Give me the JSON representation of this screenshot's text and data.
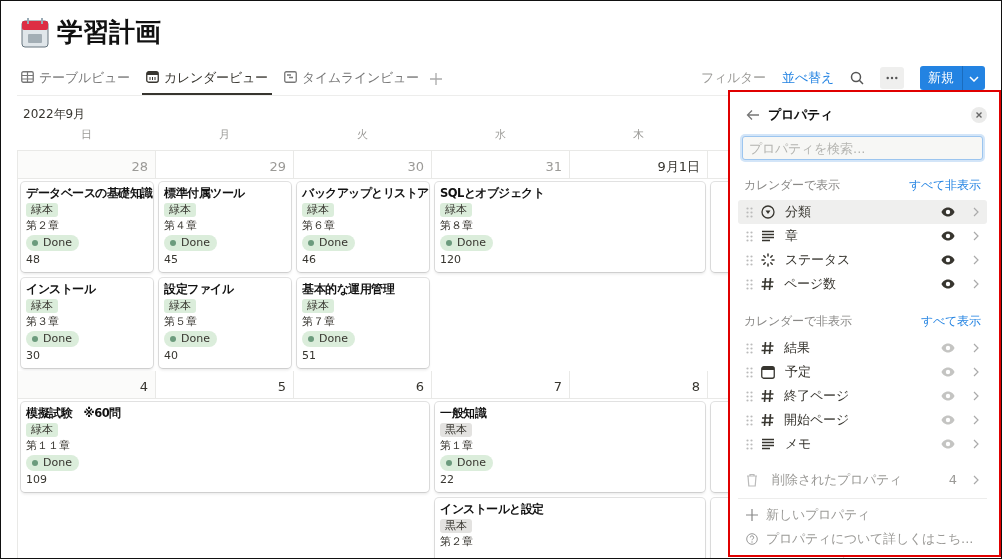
{
  "page": {
    "title": "学習計画"
  },
  "tabs": [
    {
      "label": "テーブルビュー",
      "kind": "table",
      "selected": false
    },
    {
      "label": "カレンダービュー",
      "kind": "calendar",
      "selected": true
    },
    {
      "label": "タイムラインビュー",
      "kind": "timeline",
      "selected": false
    }
  ],
  "toolbar": {
    "filter": "フィルター",
    "sort": "並べ替え",
    "new_button": "新規"
  },
  "calendar": {
    "month": "2022年9月",
    "weekdays": [
      "日",
      "月",
      "火",
      "水",
      "木"
    ],
    "weeks": [
      {
        "days": [
          {
            "kind": "date",
            "label": "28",
            "outside_month": true
          },
          {
            "kind": "date",
            "label": "29",
            "outside_month": true
          },
          {
            "kind": "date",
            "label": "30",
            "outside_month": true
          },
          {
            "kind": "date",
            "label": "31",
            "outside_month": true
          },
          {
            "kind": "date",
            "label": "9月1日",
            "outside_month": false
          },
          {
            "kind": "covered"
          },
          {
            "kind": "covered"
          }
        ],
        "lanes": [
          [
            {
              "kind": "event",
              "title": "データベースの基礎知識",
              "tag": {
                "text": "緑本",
                "color": "#dbeddb"
              },
              "chapter": "第２章",
              "status": "Done",
              "pages": "48"
            },
            {
              "kind": "event",
              "title": "標準付属ツール",
              "tag": {
                "text": "緑本",
                "color": "#dbeddb"
              },
              "chapter": "第４章",
              "status": "Done",
              "pages": "45"
            },
            {
              "kind": "event",
              "title": "バックアップとリストア",
              "tag": {
                "text": "緑本",
                "color": "#dbeddb"
              },
              "chapter": "第６章",
              "status": "Done",
              "pages": "46"
            },
            {
              "kind": "event",
              "title": "SQLとオブジェクト",
              "tag": {
                "text": "緑本",
                "color": "#dbeddb"
              },
              "chapter": "第８章",
              "status": "Done",
              "pages": "120"
            },
            {
              "kind": "continued"
            },
            {
              "kind": "covered"
            },
            {
              "kind": "empty"
            }
          ],
          [
            {
              "kind": "event",
              "title": "インストール",
              "tag": {
                "text": "緑本",
                "color": "#dbeddb"
              },
              "chapter": "第３章",
              "status": "Done",
              "pages": "30"
            },
            {
              "kind": "event",
              "title": "設定ファイル",
              "tag": {
                "text": "緑本",
                "color": "#dbeddb"
              },
              "chapter": "第５章",
              "status": "Done",
              "pages": "40"
            },
            {
              "kind": "event",
              "title": "基本的な運用管理",
              "tag": {
                "text": "緑本",
                "color": "#dbeddb"
              },
              "chapter": "第７章",
              "status": "Done",
              "pages": "51"
            },
            {
              "kind": "empty"
            },
            {
              "kind": "empty"
            },
            {
              "kind": "empty"
            },
            {
              "kind": "empty"
            }
          ]
        ]
      },
      {
        "days": [
          {
            "kind": "date",
            "label": "4",
            "outside_month": false
          },
          {
            "kind": "date",
            "label": "5",
            "outside_month": false
          },
          {
            "kind": "date",
            "label": "6",
            "outside_month": false
          },
          {
            "kind": "date",
            "label": "7",
            "outside_month": false
          },
          {
            "kind": "date",
            "label": "8",
            "outside_month": false
          },
          {
            "kind": "covered"
          },
          {
            "kind": "covered"
          }
        ],
        "lanes": [
          [
            {
              "kind": "event",
              "title": "模擬試験　※60問",
              "tag": {
                "text": "緑本",
                "color": "#dbeddb"
              },
              "chapter": "第１１章",
              "status": "Done",
              "pages": "109"
            },
            {
              "kind": "continued"
            },
            {
              "kind": "continued"
            },
            {
              "kind": "event",
              "title": "一般知識",
              "tag": {
                "text": "黒本",
                "color": "#e3e2e0"
              },
              "chapter": "第１章",
              "status": "Done",
              "pages": "22"
            },
            {
              "kind": "continued"
            },
            {
              "kind": "covered"
            },
            {
              "kind": "empty"
            }
          ],
          [
            {
              "kind": "empty"
            },
            {
              "kind": "empty"
            },
            {
              "kind": "empty"
            },
            {
              "kind": "event",
              "title": "インストールと設定",
              "tag": {
                "text": "黒本",
                "color": "#e3e2e0"
              },
              "chapter": "第２章"
            },
            {
              "kind": "continued"
            },
            {
              "kind": "covered"
            },
            {
              "kind": "empty"
            }
          ]
        ]
      }
    ]
  },
  "properties_panel": {
    "title": "プロパティ",
    "search": {
      "placeholder": "プロパティを検索..."
    },
    "shown_section": {
      "label": "カレンダーで表示",
      "action": "すべて非表示"
    },
    "shown": [
      {
        "name": "分類",
        "kind": "select",
        "visible": true,
        "highlighted": true
      },
      {
        "name": "章",
        "kind": "text",
        "visible": true,
        "highlighted": false
      },
      {
        "name": "ステータス",
        "kind": "status",
        "visible": true,
        "highlighted": false
      },
      {
        "name": "ページ数",
        "kind": "number",
        "visible": true,
        "highlighted": false
      }
    ],
    "hidden_section": {
      "label": "カレンダーで非表示",
      "action": "すべて表示"
    },
    "hidden": [
      {
        "name": "結果",
        "kind": "number",
        "visible": false,
        "highlighted": false
      },
      {
        "name": "予定",
        "kind": "date",
        "visible": false,
        "highlighted": false
      },
      {
        "name": "終了ページ",
        "kind": "number",
        "visible": false,
        "highlighted": false
      },
      {
        "name": "開始ページ",
        "kind": "number",
        "visible": false,
        "highlighted": false
      },
      {
        "name": "メモ",
        "kind": "text",
        "visible": false,
        "highlighted": false
      }
    ],
    "deleted": {
      "label": "削除されたプロパティ",
      "count": "4"
    },
    "new_property": "新しいプロパティ",
    "help": "プロパティについて詳しくはこち..."
  }
}
